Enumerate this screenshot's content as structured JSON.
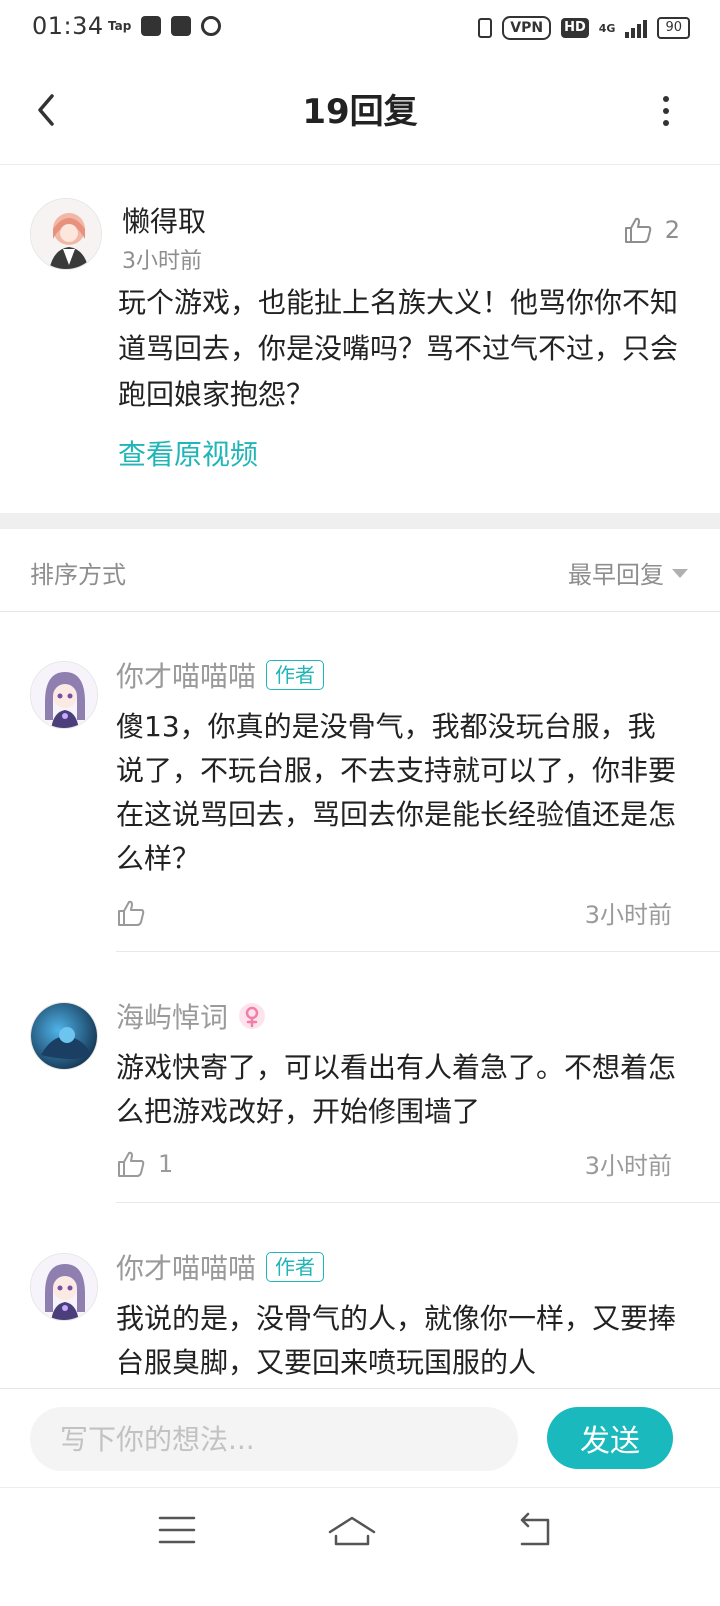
{
  "status_bar": {
    "time": "01:34",
    "tap_label": "Tap",
    "vpn": "VPN",
    "hd": "HD",
    "network": "4G",
    "battery": "90"
  },
  "header": {
    "title": "19回复"
  },
  "post": {
    "author": "懒得取",
    "time": "3小时前",
    "likes": "2",
    "body": "玩个游戏，也能扯上名族大义！他骂你你不知道骂回去，你是没嘴吗？骂不过气不过，只会跑回娘家抱怨？",
    "link": "查看原视频"
  },
  "sort": {
    "label": "排序方式",
    "selected": "最早回复"
  },
  "replies": [
    {
      "author": "你才喵喵喵",
      "badge": "作者",
      "body": "傻13，你真的是没骨气，我都没玩台服，我说了，不玩台服，不去支持就可以了，你非要在这说骂回去，骂回去你是能长经验值还是怎么样？",
      "likes": "",
      "time": "3小时前"
    },
    {
      "author": "海屿悼词",
      "body": "游戏快寄了，可以看出有人着急了。不想着怎么把游戏改好，开始修围墙了",
      "likes": "1",
      "time": "3小时前"
    },
    {
      "author": "你才喵喵喵",
      "badge": "作者",
      "body": "我说的是，没骨气的人，就像你一样，又要捧台服臭脚，又要回来喷玩国服的人"
    }
  ],
  "input": {
    "placeholder": "写下你的想法...",
    "value": "",
    "send_label": "发送"
  },
  "colors": {
    "accent": "#20b6b8",
    "send_button": "#1ab9bd",
    "muted_text": "#8e8e8e"
  },
  "icons": {
    "back": "chevron-left-icon",
    "more": "more-vertical-icon",
    "like": "thumbs-up-icon",
    "sort": "triangle-down-icon",
    "gender": "female-icon",
    "nav": [
      "menu-icon",
      "home-icon",
      "back-arrow-icon"
    ]
  }
}
